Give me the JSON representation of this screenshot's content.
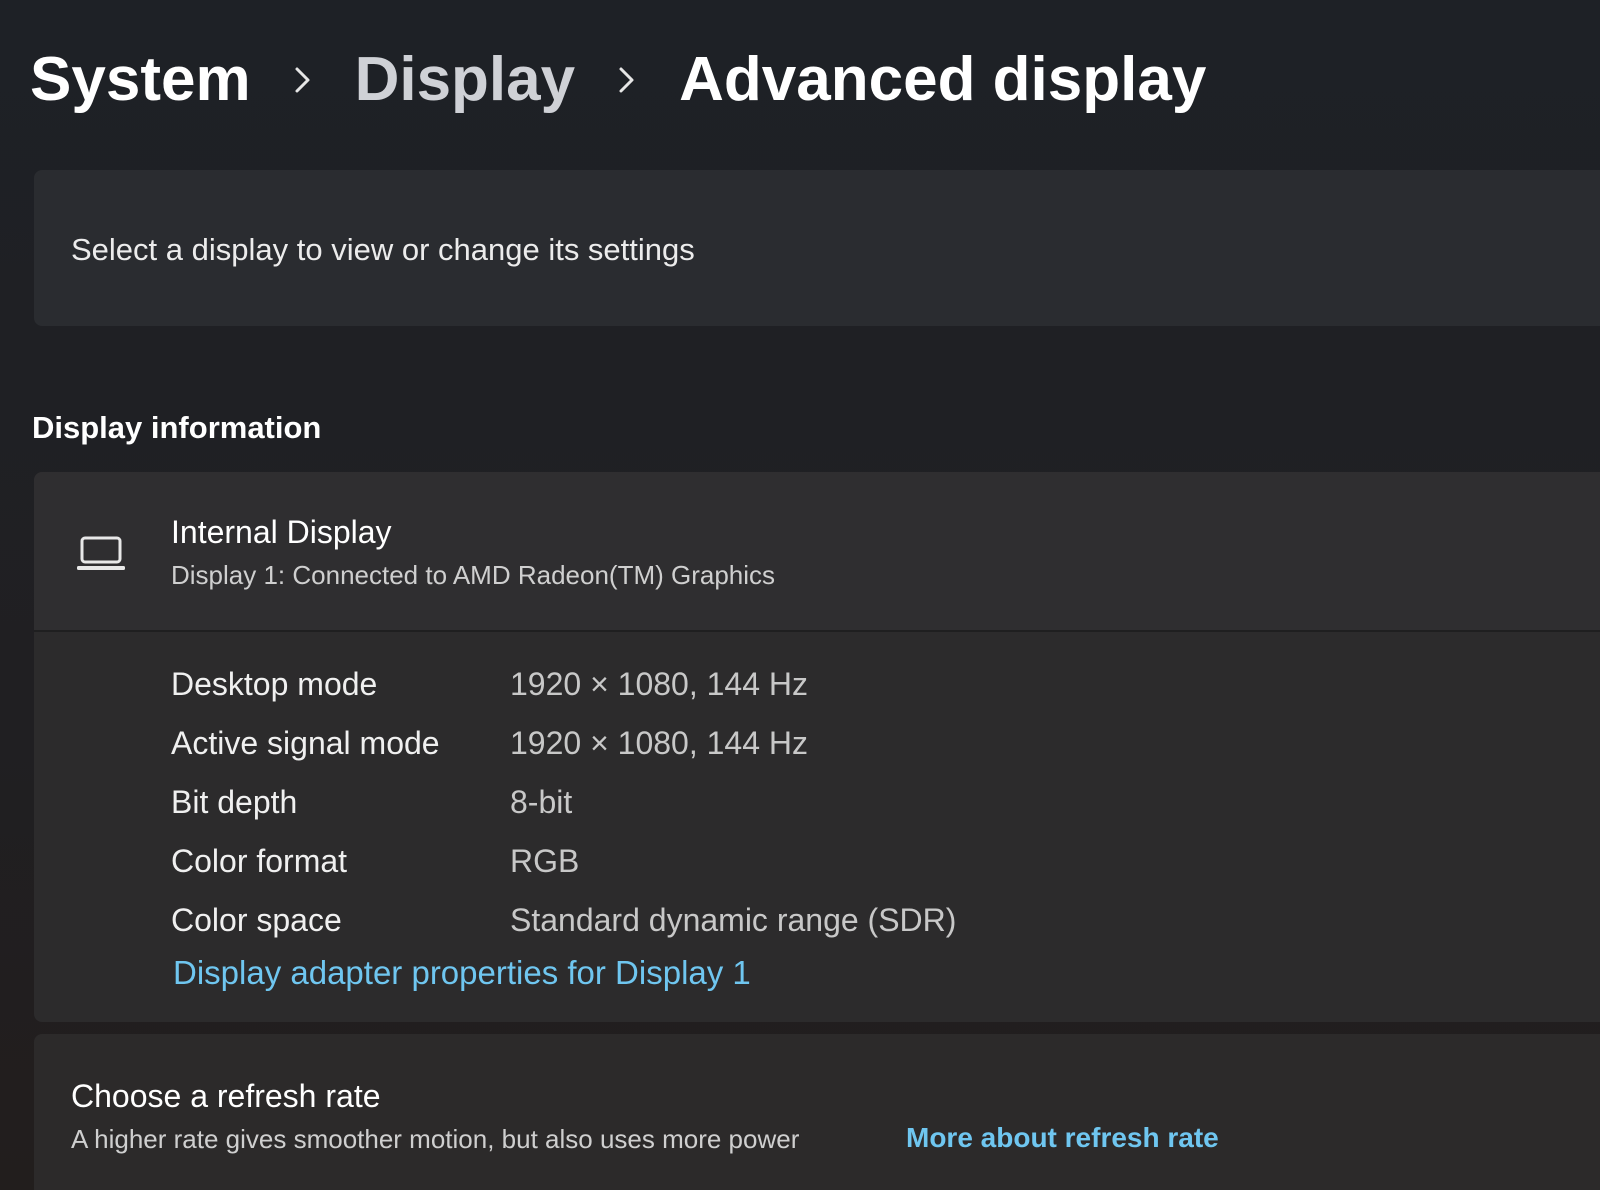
{
  "breadcrumb": {
    "items": [
      {
        "label": "System"
      },
      {
        "label": "Display"
      },
      {
        "label": "Advanced display"
      }
    ],
    "separator_icon": "chevron-right-icon"
  },
  "select_display": {
    "text": "Select a display to view or change its settings"
  },
  "display_information": {
    "section_title": "Display information",
    "header": {
      "icon": "laptop-icon",
      "title": "Internal Display",
      "subtitle": "Display 1: Connected to AMD Radeon(TM) Graphics"
    },
    "rows": [
      {
        "label": "Desktop mode",
        "value": "1920 × 1080, 144 Hz"
      },
      {
        "label": "Active signal mode",
        "value": "1920 × 1080, 144 Hz"
      },
      {
        "label": "Bit depth",
        "value": "8-bit"
      },
      {
        "label": "Color format",
        "value": "RGB"
      },
      {
        "label": "Color space",
        "value": "Standard dynamic range (SDR)"
      }
    ],
    "adapter_link": "Display adapter properties for Display 1"
  },
  "refresh_rate": {
    "title": "Choose a refresh rate",
    "description": "A higher rate gives smoother motion, but also uses more power",
    "link": "More about refresh rate"
  },
  "colors": {
    "background": "#1e2126",
    "card": "#2c2b2c",
    "link": "#6fc6f0",
    "text_primary": "#ffffff",
    "text_secondary": "#c8c8c8"
  }
}
